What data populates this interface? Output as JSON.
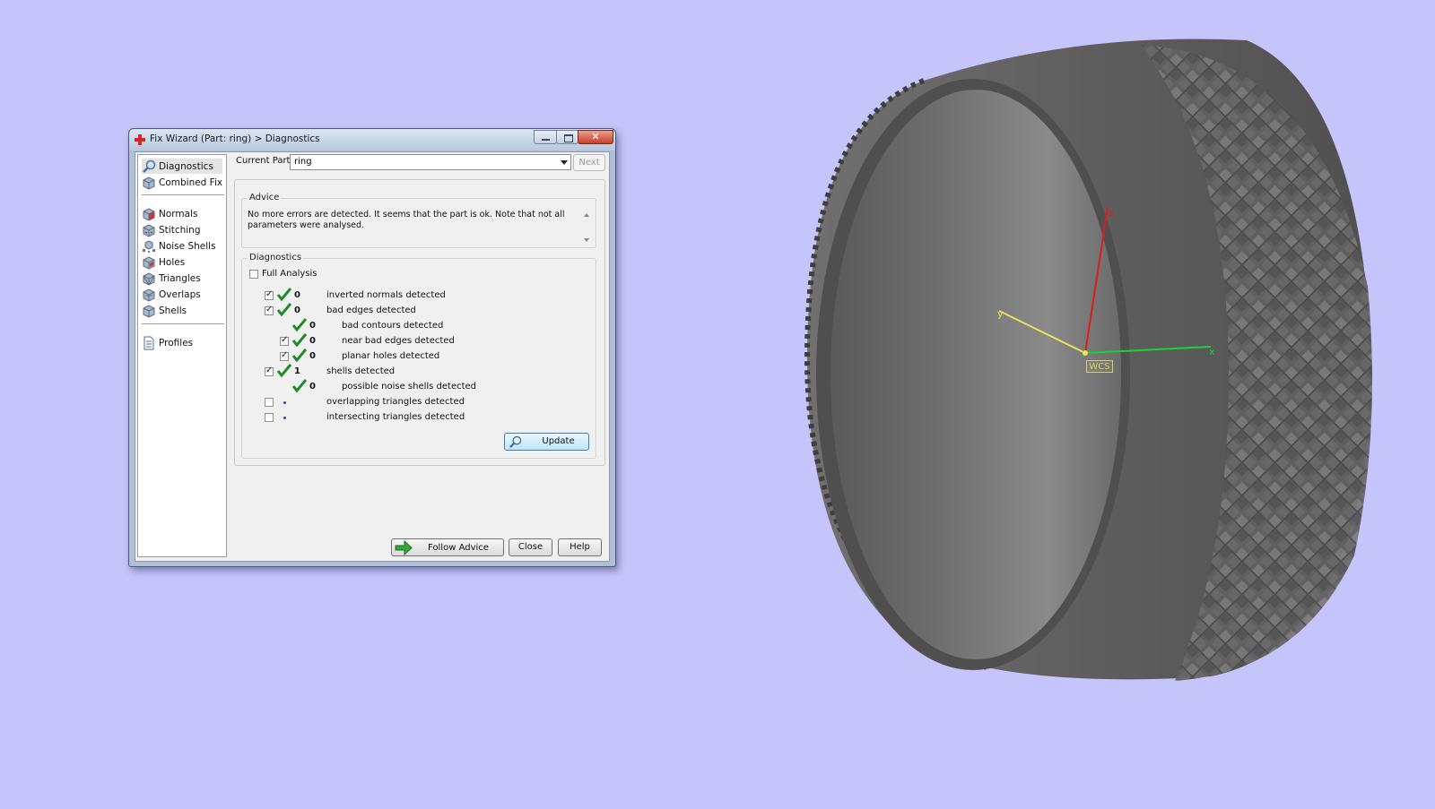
{
  "window": {
    "title": "Fix Wizard (Part: ring) > Diagnostics",
    "close_glyph": "✕"
  },
  "nav": {
    "items": [
      {
        "label": "Diagnostics",
        "icon": "magnifier-icon",
        "selected": true
      },
      {
        "label": "Combined Fix",
        "icon": "cube-icon"
      },
      {
        "label": "Normals",
        "icon": "normals-cube-icon"
      },
      {
        "label": "Stitching",
        "icon": "stitching-cube-icon"
      },
      {
        "label": "Noise Shells",
        "icon": "noise-shells-icon"
      },
      {
        "label": "Holes",
        "icon": "holes-cube-icon"
      },
      {
        "label": "Triangles",
        "icon": "triangles-cube-icon"
      },
      {
        "label": "Overlaps",
        "icon": "overlaps-cube-icon"
      },
      {
        "label": "Shells",
        "icon": "shells-cube-icon"
      },
      {
        "label": "Profiles",
        "icon": "document-icon"
      }
    ]
  },
  "current_part": {
    "label": "Current Part:",
    "value": "ring",
    "next_label": "Next"
  },
  "advice": {
    "title": "Advice",
    "text": "No more errors are detected. It seems that the part is ok. Note that not all parameters were analysed."
  },
  "diagnostics": {
    "title": "Diagnostics",
    "full_analysis_label": "Full Analysis",
    "full_analysis_checked": false,
    "rows": [
      {
        "checkbox": true,
        "checked": true,
        "status": "ok",
        "count": "0",
        "text": "inverted normals detected",
        "indent": 0
      },
      {
        "checkbox": true,
        "checked": true,
        "status": "ok",
        "count": "0",
        "text": "bad edges detected",
        "indent": 0
      },
      {
        "checkbox": false,
        "checked": false,
        "status": "ok",
        "count": "0",
        "text": "bad contours detected",
        "indent": 1
      },
      {
        "checkbox": true,
        "checked": true,
        "status": "ok",
        "count": "0",
        "text": "near bad edges detected",
        "indent": 1
      },
      {
        "checkbox": true,
        "checked": true,
        "status": "ok",
        "count": "0",
        "text": "planar holes detected",
        "indent": 1
      },
      {
        "checkbox": true,
        "checked": true,
        "status": "ok",
        "count": "1",
        "text": "shells detected",
        "indent": 0
      },
      {
        "checkbox": false,
        "checked": false,
        "status": "ok",
        "count": "0",
        "text": "possible noise shells detected",
        "indent": 1
      },
      {
        "checkbox": true,
        "checked": false,
        "status": "none",
        "count": "",
        "text": "overlapping triangles detected",
        "indent": 0
      },
      {
        "checkbox": true,
        "checked": false,
        "status": "none",
        "count": "",
        "text": "intersecting triangles detected",
        "indent": 0
      }
    ],
    "update_label": "Update"
  },
  "footer": {
    "follow_advice_label": "Follow Advice",
    "close_label": "Close",
    "help_label": "Help"
  },
  "viewport": {
    "axis_labels": {
      "x": "x",
      "y": "y",
      "z": "z"
    },
    "wcs_label": "WCS",
    "background_color": "#c5c5fb",
    "model_color": "#6e6e6e"
  }
}
